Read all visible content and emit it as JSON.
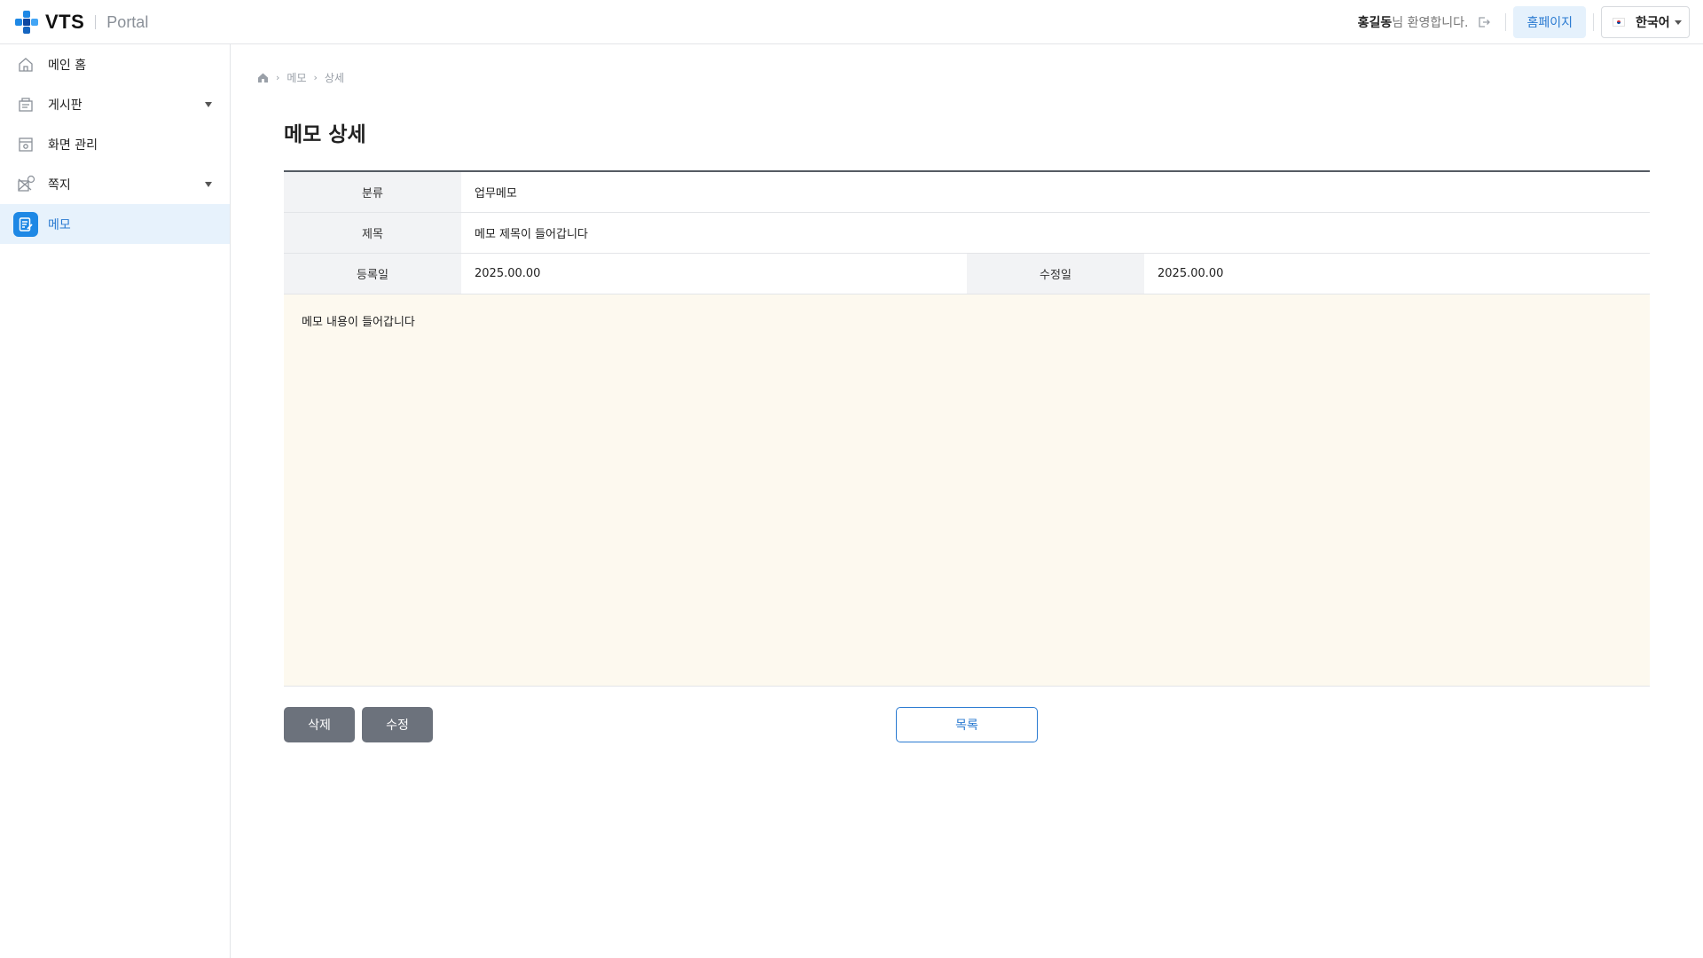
{
  "header": {
    "logo_text": "VTS",
    "logo_sub": "Portal",
    "user_name": "홍길동",
    "welcome_suffix": "님 환영합니다.",
    "homepage_label": "홈페이지",
    "language": "한국어"
  },
  "sidebar": {
    "items": [
      {
        "label": "메인 홈",
        "icon": "home-icon",
        "has_submenu": false,
        "active": false
      },
      {
        "label": "게시판",
        "icon": "board-icon",
        "has_submenu": true,
        "active": false
      },
      {
        "label": "화면 관리",
        "icon": "screen-manage-icon",
        "has_submenu": false,
        "active": false
      },
      {
        "label": "쪽지",
        "icon": "message-icon",
        "has_submenu": true,
        "active": false
      },
      {
        "label": "메모",
        "icon": "memo-icon",
        "has_submenu": false,
        "active": true
      }
    ]
  },
  "breadcrumb": {
    "items": [
      "메모",
      "상세"
    ]
  },
  "page": {
    "title": "메모 상세"
  },
  "detail": {
    "category_label": "분류",
    "category_value": "업무메모",
    "title_label": "제목",
    "title_value": "메모 제목이 들어갑니다",
    "created_label": "등록일",
    "created_value": "2025.00.00",
    "modified_label": "수정일",
    "modified_value": "2025.00.00",
    "content": "메모 내용이 들어갑니다"
  },
  "actions": {
    "delete_label": "삭제",
    "edit_label": "수정",
    "list_label": "목록"
  },
  "colors": {
    "accent": "#1e88e5",
    "active_bg": "#e7f2fc",
    "content_bg": "#fdf9ef",
    "button_dark": "#6c727c"
  }
}
